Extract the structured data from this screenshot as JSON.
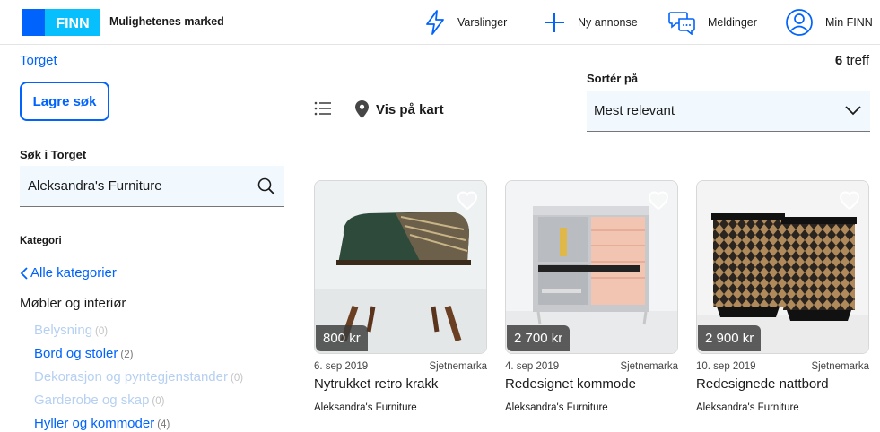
{
  "header": {
    "brand": "FINN",
    "tagline": "Mulighetenes marked",
    "nav": {
      "alerts": "Varslinger",
      "new_ad": "Ny annonse",
      "messages": "Meldinger",
      "account": "Min FINN"
    }
  },
  "breadcrumb": "Torget",
  "save_search": "Lagre søk",
  "search": {
    "label": "Søk i Torget",
    "value": "Aleksandra's Furniture"
  },
  "category": {
    "label": "Kategori",
    "all": "Alle kategorier",
    "main": "Møbler og interiør",
    "subs": [
      {
        "label": "Belysning",
        "count": "(0)"
      },
      {
        "label": "Bord og stoler",
        "count": "(2)"
      },
      {
        "label": "Dekorasjon og pyntegjenstander",
        "count": "(0)"
      },
      {
        "label": "Garderobe og skap",
        "count": "(0)"
      },
      {
        "label": "Hyller og kommoder",
        "count": "(4)"
      }
    ]
  },
  "view": {
    "map_label": "Vis på kart"
  },
  "results": {
    "count": "6",
    "suffix": "treff"
  },
  "sort": {
    "label": "Sortér på",
    "value": "Mest relevant"
  },
  "listings": [
    {
      "price": "800 kr",
      "date": "6. sep 2019",
      "location": "Sjetnemarka",
      "title": "Nytrukket retro krakk",
      "seller": "Aleksandra's Furniture"
    },
    {
      "price": "2 700 kr",
      "date": "4. sep 2019",
      "location": "Sjetnemarka",
      "title": "Redesignet kommode",
      "seller": "Aleksandra's Furniture"
    },
    {
      "price": "2 900 kr",
      "date": "10. sep 2019",
      "location": "Sjetnemarka",
      "title": "Redesignede nattbord",
      "seller": "Aleksandra's Furniture"
    }
  ],
  "colors": {
    "accent": "#0063fb",
    "field_bg": "#f1f9ff",
    "logo_light": "#06bffc"
  }
}
